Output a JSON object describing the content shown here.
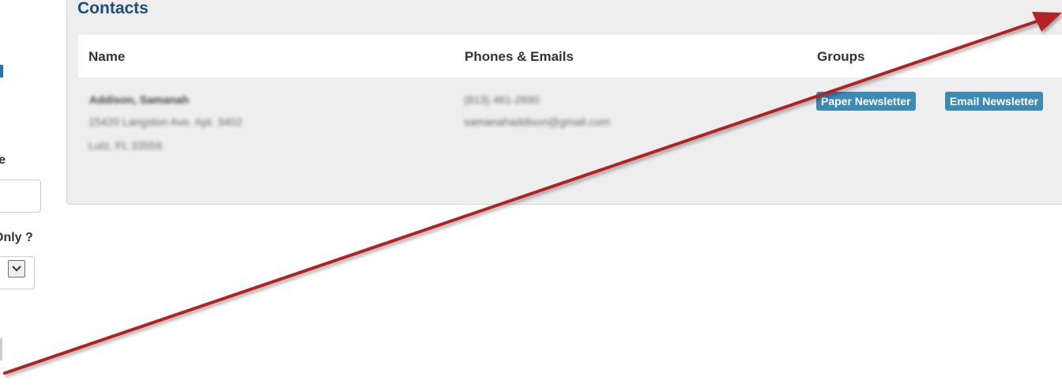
{
  "sidebar": {
    "filter_only_label": "Only ?"
  },
  "contacts": {
    "title": "Contacts",
    "columns": [
      "Name",
      "Phones & Emails",
      "Groups"
    ],
    "rows": [
      {
        "name": "Addison, Samanah",
        "address_line1": "15420 Langston Ave. Apt. 3402",
        "address_line2": "Lutz, FL 33559",
        "phone": "(813) 461-2690",
        "email": "samanahaddison@gmail.com",
        "groups": [
          "Paper Newsletter",
          "Email Newsletter"
        ]
      }
    ]
  },
  "colors": {
    "title": "#1f4e79",
    "badge": "#3d8ab5",
    "panel_bg": "#eeeeee",
    "annotation_arrow": "#b22222"
  },
  "icons": {
    "select_arrow": "chevron-down-icon",
    "annotation": "red-arrow"
  }
}
